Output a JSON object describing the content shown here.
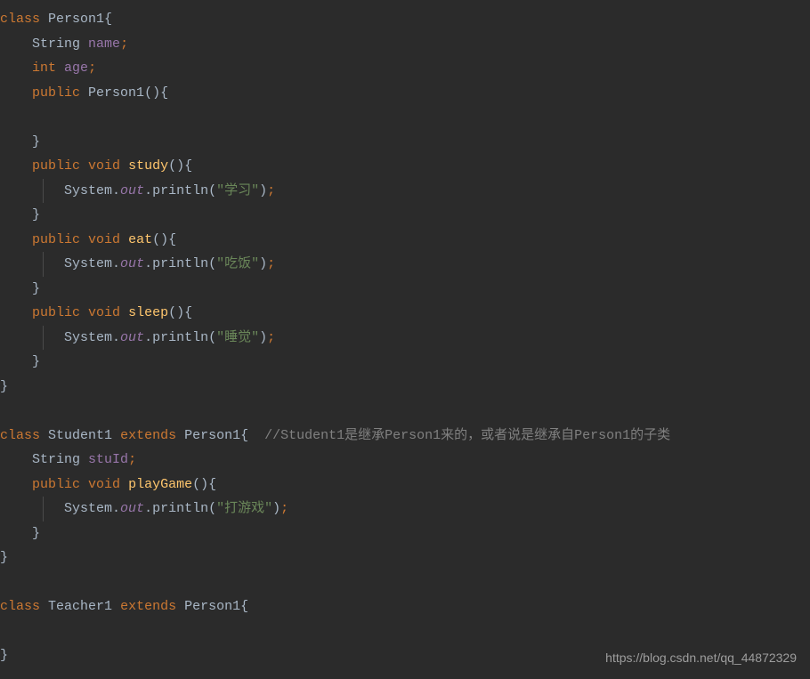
{
  "code": {
    "kw_class": "class",
    "kw_public": "public",
    "kw_void": "void",
    "kw_int": "int",
    "kw_extends": "extends",
    "type_string": "String",
    "cls_person1": "Person1",
    "cls_student1": "Student1",
    "cls_teacher1": "Teacher1",
    "field_name": "name",
    "field_age": "age",
    "field_stuId": "stuId",
    "method_study": "study",
    "method_eat": "eat",
    "method_sleep": "sleep",
    "method_playGame": "playGame",
    "constructor_person1": "Person1",
    "system": "System",
    "out": "out",
    "println": "println",
    "str_study": "\"学习\"",
    "str_eat": "\"吃饭\"",
    "str_sleep": "\"睡觉\"",
    "str_play": "\"打游戏\"",
    "comment_student": "//Student1是继承Person1来的，或者说是继承自Person1的子类",
    "semicolon": ";",
    "lbrace": "{",
    "rbrace": "}",
    "lparen": "(",
    "rparen": ")",
    "dot": ".",
    "space": " "
  },
  "watermark": "https://blog.csdn.net/qq_44872329"
}
